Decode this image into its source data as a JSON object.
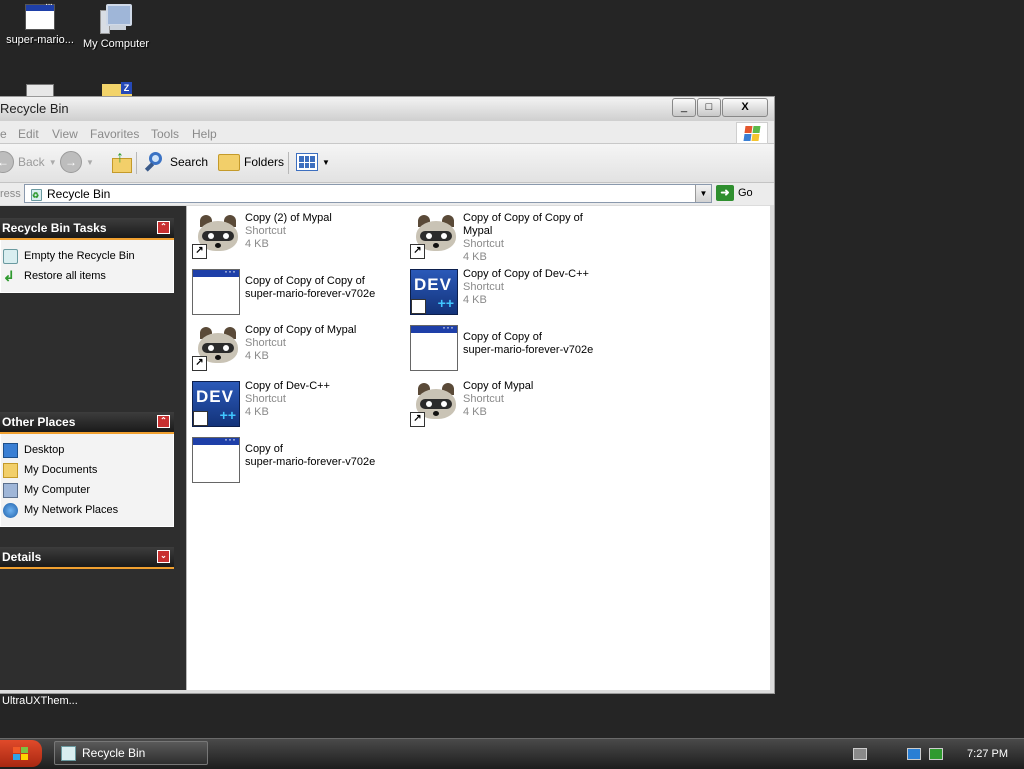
{
  "desktop": {
    "icons": [
      {
        "label": "super-mario...",
        "icon": "window-app-icon"
      },
      {
        "label": "My Computer",
        "icon": "my-computer-icon"
      }
    ],
    "caption": "UltraUXThem..."
  },
  "window": {
    "title": "Recycle Bin",
    "buttons": {
      "minimize": "_",
      "maximize": "□",
      "close": "X"
    }
  },
  "menu": [
    "e",
    "Edit",
    "View",
    "Favorites",
    "Tools",
    "Help"
  ],
  "toolbar": {
    "back": "Back",
    "search": "Search",
    "folders": "Folders"
  },
  "address": {
    "label": "ress",
    "value": "Recycle Bin",
    "go": "Go"
  },
  "taskpane": {
    "tasks": {
      "title": "Recycle Bin Tasks",
      "items": [
        "Empty the Recycle Bin",
        "Restore all items"
      ]
    },
    "places": {
      "title": "Other Places",
      "items": [
        "Desktop",
        "My Documents",
        "My Computer",
        "My Network Places"
      ]
    },
    "details": {
      "title": "Details"
    }
  },
  "files": [
    {
      "name1": "Copy (2) of Mypal",
      "name2": "",
      "type": "Shortcut",
      "size": "4 KB",
      "icon": "raccoon"
    },
    {
      "name1": "Copy of Copy of Copy of Mypal",
      "name2": "",
      "type": "Shortcut",
      "size": "4 KB",
      "icon": "raccoon"
    },
    {
      "name1": "Copy of Copy of Copy of",
      "name2": "super-mario-forever-v702e",
      "type": "",
      "size": "",
      "icon": "appwin"
    },
    {
      "name1": "Copy of Copy of Dev-C++",
      "name2": "",
      "type": "Shortcut",
      "size": "4 KB",
      "icon": "dev"
    },
    {
      "name1": "Copy of Copy of Mypal",
      "name2": "",
      "type": "Shortcut",
      "size": "4 KB",
      "icon": "raccoon"
    },
    {
      "name1": "Copy of Copy of",
      "name2": "super-mario-forever-v702e",
      "type": "",
      "size": "",
      "icon": "appwin"
    },
    {
      "name1": "Copy of Dev-C++",
      "name2": "",
      "type": "Shortcut",
      "size": "4 KB",
      "icon": "dev"
    },
    {
      "name1": "Copy of Mypal",
      "name2": "",
      "type": "Shortcut",
      "size": "4 KB",
      "icon": "raccoon"
    },
    {
      "name1": "Copy of",
      "name2": "super-mario-forever-v702e",
      "type": "",
      "size": "",
      "icon": "appwin"
    }
  ],
  "taskbar": {
    "task": "Recycle Bin",
    "clock": "7:27 PM"
  }
}
